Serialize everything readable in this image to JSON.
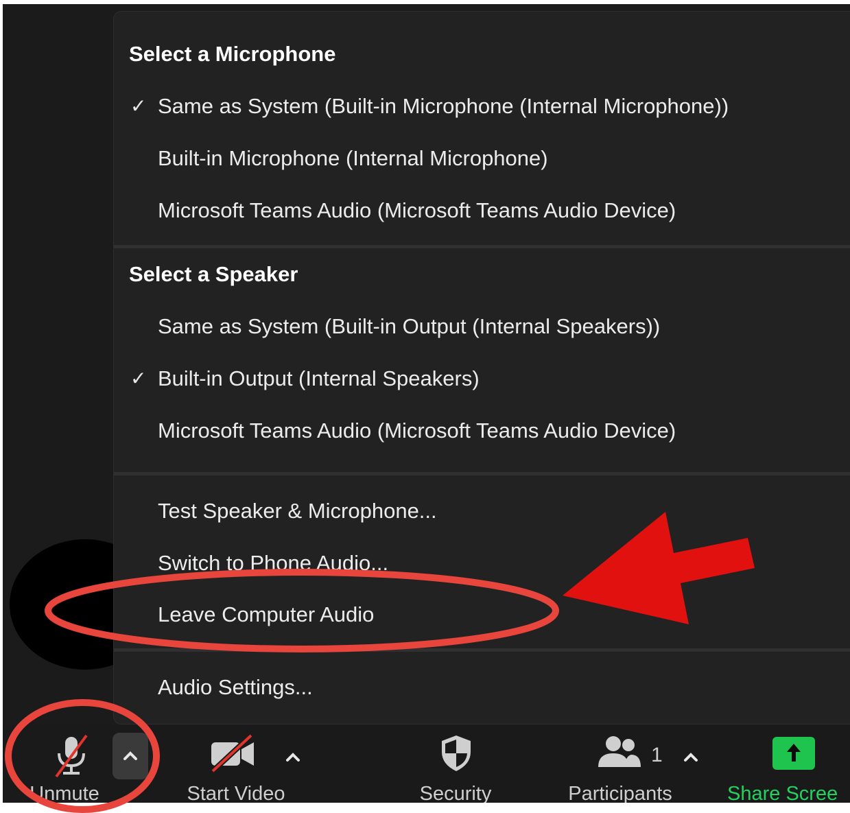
{
  "menu": {
    "microphone": {
      "heading": "Select a Microphone",
      "items": [
        {
          "label": "Same as System (Built-in Microphone (Internal Microphone))",
          "checked": true
        },
        {
          "label": "Built-in Microphone (Internal Microphone)",
          "checked": false
        },
        {
          "label": "Microsoft Teams Audio (Microsoft Teams Audio Device)",
          "checked": false
        }
      ]
    },
    "speaker": {
      "heading": "Select a Speaker",
      "items": [
        {
          "label": "Same as System (Built-in Output (Internal Speakers))",
          "checked": false
        },
        {
          "label": "Built-in Output (Internal Speakers)",
          "checked": true
        },
        {
          "label": "Microsoft Teams Audio (Microsoft Teams Audio Device)",
          "checked": false
        }
      ]
    },
    "actions": [
      {
        "label": "Test Speaker & Microphone..."
      },
      {
        "label": "Switch to Phone Audio..."
      },
      {
        "label": "Leave Computer Audio"
      }
    ],
    "settings": {
      "label": "Audio Settings..."
    },
    "check_glyph": "✓"
  },
  "toolbar": {
    "unmute": {
      "label": "Unmute",
      "icon": "mic-muted-icon",
      "caret": "^"
    },
    "video": {
      "label": "Start Video",
      "icon": "video-off-icon",
      "caret": "^"
    },
    "security": {
      "label": "Security",
      "icon": "shield-icon"
    },
    "participants": {
      "label": "Participants",
      "count": "1",
      "icon": "participants-icon",
      "caret": "^"
    },
    "share": {
      "label": "Share Scree",
      "icon": "share-arrow-icon"
    }
  },
  "colors": {
    "menu_bg": "#222222",
    "toolbar_bg": "#1a1a1a",
    "share_green": "#1fc44f",
    "annotation_red": "#e8453c",
    "arrow_red": "#e0110f"
  }
}
